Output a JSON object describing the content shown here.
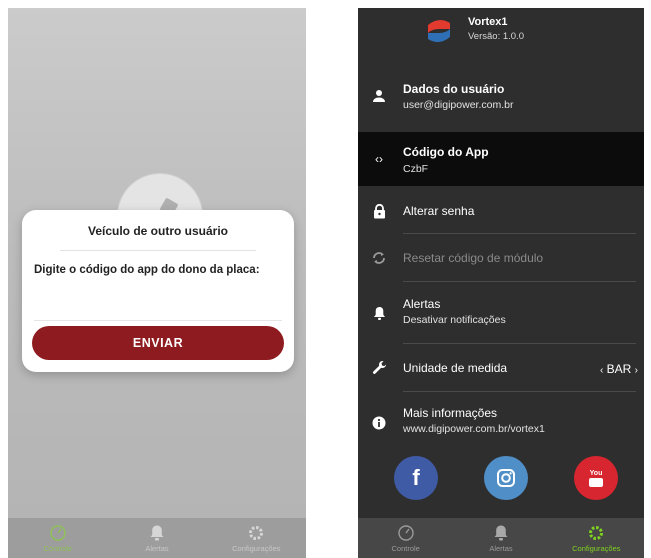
{
  "colors": {
    "brand_red": "#8e1b1f",
    "drawer_bg": "#2e2e2e",
    "selected_bg": "#0c0c0c",
    "active_green": "#7fd31f",
    "facebook": "#3f5ba5",
    "instagram": "#4f8ec6",
    "youtube": "#d7262f"
  },
  "left": {
    "dialog": {
      "title": "Veículo de outro usuário",
      "message": "Digite o código do app do dono da placa:",
      "input_value": "",
      "submit_label": "ENVIAR"
    },
    "nav": [
      {
        "label": "Controle",
        "icon": "gauge-icon",
        "active": true
      },
      {
        "label": "Alertas",
        "icon": "bell-icon",
        "active": false
      },
      {
        "label": "Configurações",
        "icon": "gear-icon",
        "active": false
      }
    ]
  },
  "right": {
    "brand": {
      "name": "Vortex1",
      "version": "Versão: 1.0.0",
      "icon": "vortex-logo"
    },
    "menu": [
      {
        "title": "Dados do usuário",
        "subtitle": "user@digipower.com.br",
        "icon": "person-icon"
      },
      {
        "title": "Código do App",
        "subtitle": "CzbF",
        "icon": "code-icon",
        "selected": true
      },
      {
        "title": "Alterar senha",
        "icon": "lock-icon"
      },
      {
        "title": "Resetar código de módulo",
        "icon": "sync-icon",
        "disabled": true
      },
      {
        "title": "Alertas",
        "subtitle": "Desativar notificações",
        "icon": "bell-icon"
      },
      {
        "title": "Unidade de medida",
        "value": "BAR",
        "icon": "wrench-icon"
      },
      {
        "title": "Mais informações",
        "subtitle": "www.digipower.com.br/vortex1",
        "icon": "info-icon"
      }
    ],
    "social": [
      {
        "name": "facebook",
        "icon": "facebook-icon",
        "glyph": "f"
      },
      {
        "name": "instagram",
        "icon": "instagram-icon"
      },
      {
        "name": "youtube",
        "icon": "youtube-icon",
        "glyph": "You"
      }
    ],
    "nav": [
      {
        "label": "Controle",
        "icon": "gauge-icon",
        "active": false
      },
      {
        "label": "Alertas",
        "icon": "bell-icon",
        "active": false
      },
      {
        "label": "Configurações",
        "icon": "gear-icon",
        "active": true
      }
    ]
  }
}
